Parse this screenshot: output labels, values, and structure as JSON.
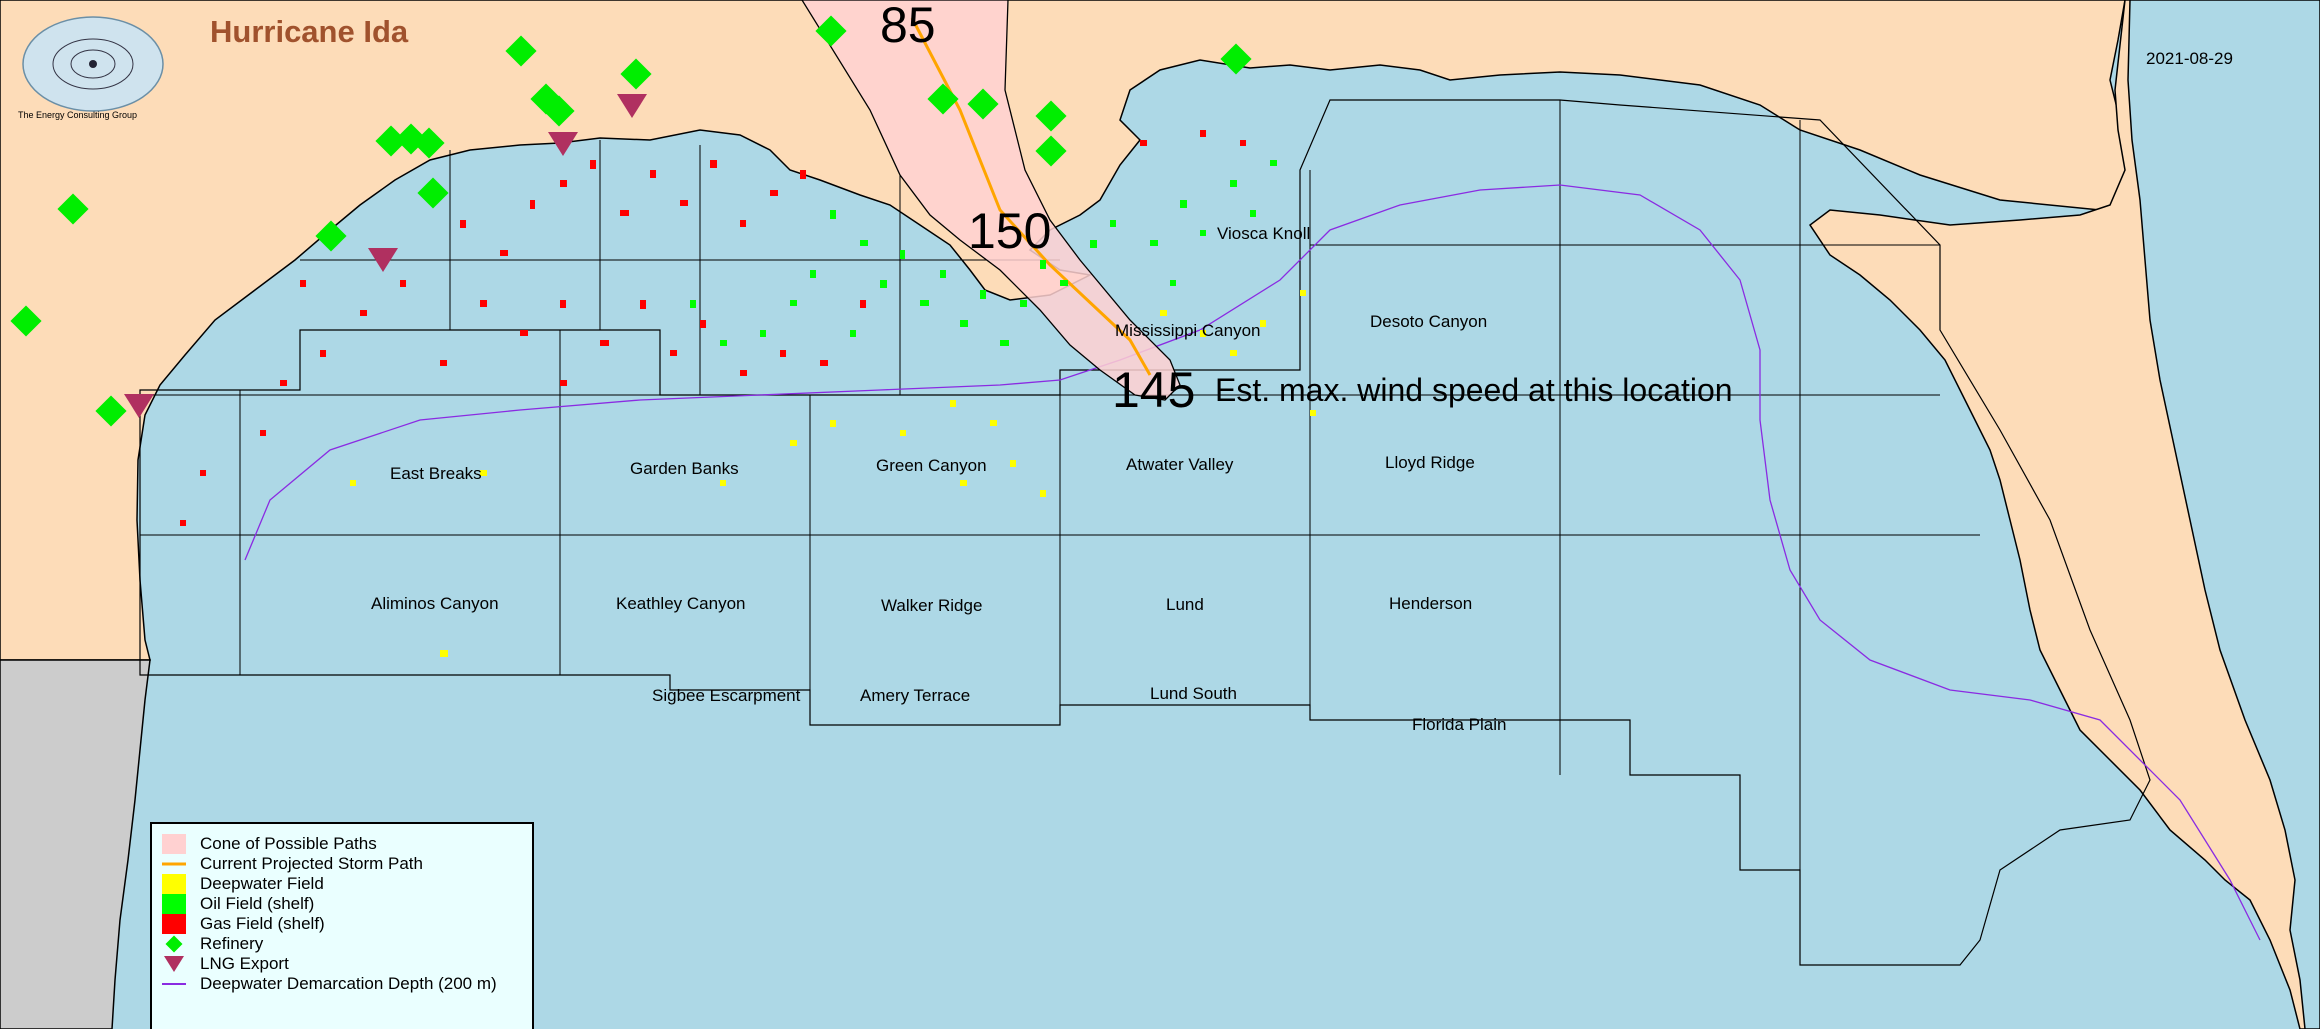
{
  "title": "Hurricane Ida",
  "date": "2021-08-29",
  "logo": {
    "caption": "The Energy Consulting Group"
  },
  "colors": {
    "land": "#fddcb8",
    "water": "#add8e6",
    "mexico_land": "#cccccc",
    "cone": "#ffd1d1",
    "storm_path": "#ffa500",
    "deepwater": "#ffff00",
    "oil": "#00ff00",
    "gas": "#ff0000",
    "refinery": "#00ee00",
    "lng": "#b03060",
    "demarcation": "#8a2be2"
  },
  "storm": {
    "wind_speeds": [
      "85",
      "150",
      "145"
    ],
    "annotation": "Est. max. wind speed at this location"
  },
  "areas": [
    "Viosca Knoll",
    "Mississippi Canyon",
    "Desoto Canyon",
    "East Breaks",
    "Garden Banks",
    "Green Canyon",
    "Atwater Valley",
    "Lloyd Ridge",
    "Aliminos Canyon",
    "Keathley Canyon",
    "Walker Ridge",
    "Lund",
    "Henderson",
    "Sigbee Escarpment",
    "Amery Terrace",
    "Lund South",
    "Florida Plain"
  ],
  "legend": {
    "items": [
      {
        "label": "Cone of Possible Paths",
        "symbol": "cone"
      },
      {
        "label": "Current Projected Storm Path",
        "symbol": "path"
      },
      {
        "label": "Deepwater Field",
        "symbol": "deepwater"
      },
      {
        "label": "Oil Field (shelf)",
        "symbol": "oil"
      },
      {
        "label": "Gas Field (shelf)",
        "symbol": "gas"
      },
      {
        "label": "Refinery",
        "symbol": "refinery"
      },
      {
        "label": "LNG Export",
        "symbol": "lng"
      },
      {
        "label": "Deepwater Demarcation Depth (200 m)",
        "symbol": "demarcation"
      }
    ]
  }
}
